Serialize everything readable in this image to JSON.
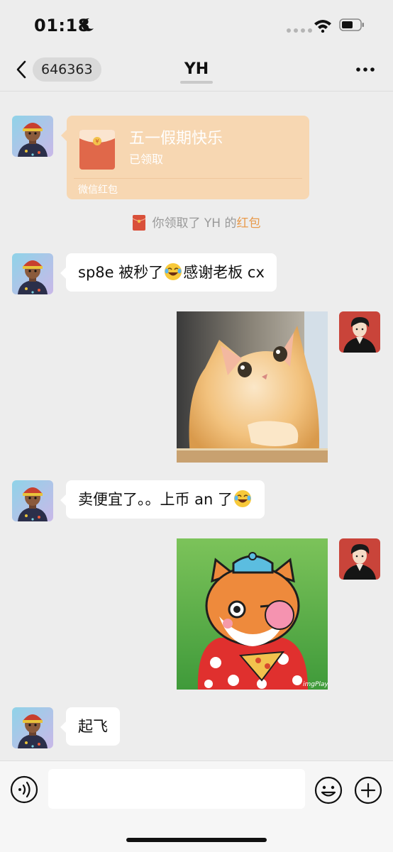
{
  "status_bar": {
    "time": "01:18"
  },
  "nav": {
    "unread_count": "646363",
    "title": "YH"
  },
  "messages": [
    {
      "type": "red_packet",
      "sender": "other",
      "title": "五一假期快乐",
      "status": "已领取",
      "footer": "微信红包"
    },
    {
      "type": "system",
      "parts": [
        "你领取了 YH 的",
        "红包"
      ]
    },
    {
      "type": "text",
      "sender": "other",
      "parts": [
        "sp8e 被秒了",
        "感谢老板 cx"
      ],
      "emoji": "laughing-tears"
    },
    {
      "type": "image",
      "sender": "me",
      "subject": "cat-sticker"
    },
    {
      "type": "text",
      "sender": "other",
      "parts": [
        "卖便宜了。。上币 an 了"
      ],
      "emoji": "laughing-tears"
    },
    {
      "type": "image",
      "sender": "me",
      "subject": "shiba-sticker",
      "watermark": "imgPlay"
    },
    {
      "type": "text",
      "sender": "other",
      "parts": [
        "起飞"
      ]
    }
  ],
  "input": {
    "placeholder": ""
  },
  "colors": {
    "background": "#ededed",
    "red_packet": "#f7d7b2",
    "link_accent": "#e89a4c"
  }
}
